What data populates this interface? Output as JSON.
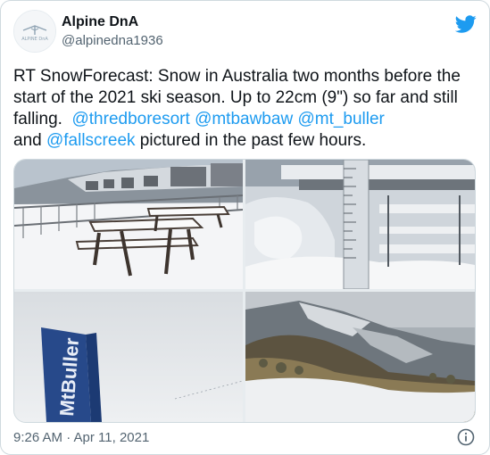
{
  "author": {
    "display_name": "Alpine DnA",
    "handle": "@alpinedna1936",
    "avatar_text": "ALPINE DnA"
  },
  "tweet": {
    "text_intro": "RT SnowForecast: Snow in Australia two months before the start of the 2021 ski season. Up to 22cm (9\") so far and still falling.  ",
    "mentions": [
      "@thredboresort",
      "@mtbawbaw",
      "@mt_buller"
    ],
    "connector": "and",
    "last_mention": "@fallscreek",
    "text_outro": " pictured in the past few hours."
  },
  "photos": {
    "flag_text": "MtBuller"
  },
  "footer": {
    "timestamp": "9:26 AM · Apr 11, 2021"
  },
  "colors": {
    "link": "#1d9bf0",
    "secondary_text": "#536471",
    "twitter_blue": "#1d9bf0"
  },
  "icons": {
    "brand": "twitter-bird-icon",
    "info": "info-circle-icon"
  }
}
